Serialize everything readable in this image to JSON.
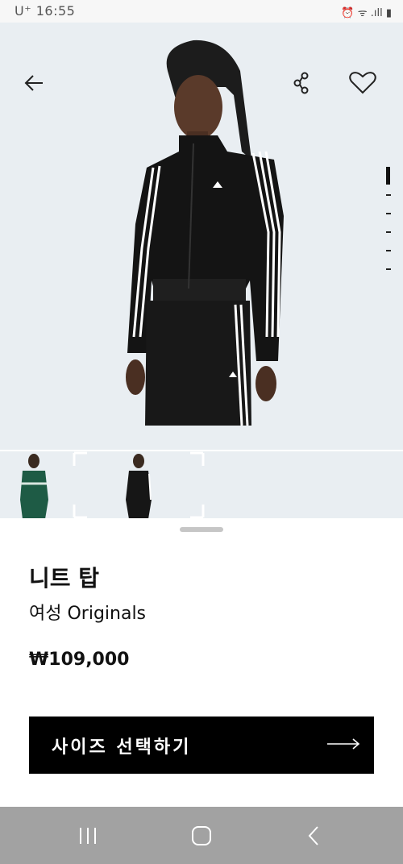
{
  "status_bar": {
    "time": "U⁺ 16:55",
    "right_icons": "⏰ ᯤ .ıll ▮"
  },
  "hero": {
    "back_icon": "arrow-left-icon",
    "share_icon": "share-icon",
    "wishlist_icon": "heart-icon"
  },
  "gallery_dots": {
    "count": 6,
    "active": 0
  },
  "product": {
    "name": "니트 탑",
    "subtitle": "여성 Originals",
    "price": "₩109,000"
  },
  "cta": {
    "label": "사이즈 선택하기"
  },
  "colors": {
    "cta_bg": "#000000",
    "hero_bg": "#e9eef2",
    "navbar_bg": "#a2a2a2"
  }
}
